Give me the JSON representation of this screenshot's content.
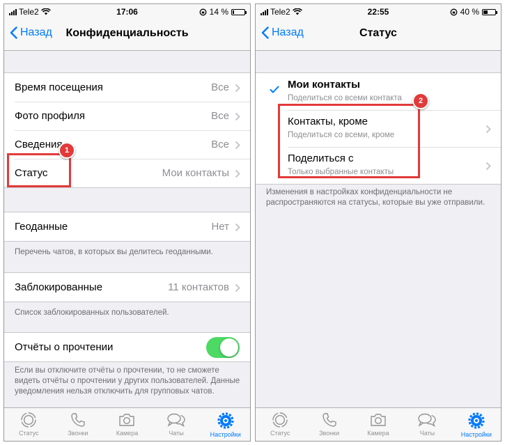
{
  "colors": {
    "accent": "#007aff",
    "toggle_on": "#4cd964",
    "callout": "#e23a3a"
  },
  "left": {
    "statusbar": {
      "carrier": "Tele2",
      "time": "17:06",
      "battery": "14 %",
      "battery_level": 0.14
    },
    "nav": {
      "back_label": "Назад",
      "title": "Конфиденциальность"
    },
    "rows": [
      {
        "label": "Время посещения",
        "value": "Все"
      },
      {
        "label": "Фото профиля",
        "value": "Все"
      },
      {
        "label": "Сведения",
        "value": "Все"
      },
      {
        "label": "Статус",
        "value": "Мои контакты"
      }
    ],
    "live_location": {
      "label": "Геоданные",
      "value": "Нет",
      "footnote": "Перечень чатов, в которых вы делитесь геоданными."
    },
    "blocked": {
      "label": "Заблокированные",
      "value": "11 контактов",
      "footnote": "Список заблокированных пользователей."
    },
    "read_receipts": {
      "label": "Отчёты о прочтении",
      "enabled": true,
      "footnote": "Если вы отключите отчёты о прочтении, то не сможете видеть отчёты о прочтении у других пользователей. Данные уведомления нельзя отключить для групповых чатов."
    },
    "callout_number": "1"
  },
  "right": {
    "statusbar": {
      "carrier": "Tele2",
      "time": "22:55",
      "battery": "40 %",
      "battery_level": 0.4
    },
    "nav": {
      "back_label": "Назад",
      "title": "Статус"
    },
    "options": [
      {
        "title": "Мои контакты",
        "subtitle": "Поделиться со всеми контакта",
        "selected": true
      },
      {
        "title": "Контакты, кроме",
        "subtitle": "Поделиться со всеми, кроме",
        "selected": false
      },
      {
        "title": "Поделиться с",
        "subtitle": "Только выбранные контакты",
        "selected": false
      }
    ],
    "footnote": "Изменения в настройках конфиденциальности не распространяются на статусы, которые вы уже отправили.",
    "callout_number": "2"
  },
  "tabs": [
    {
      "label": "Статус",
      "icon": "status-icon",
      "active": false
    },
    {
      "label": "Звонки",
      "icon": "phone-icon",
      "active": false
    },
    {
      "label": "Камера",
      "icon": "camera-icon",
      "active": false
    },
    {
      "label": "Чаты",
      "icon": "chats-icon",
      "active": false
    },
    {
      "label": "Настройки",
      "icon": "settings-gear-icon",
      "active": true
    }
  ]
}
